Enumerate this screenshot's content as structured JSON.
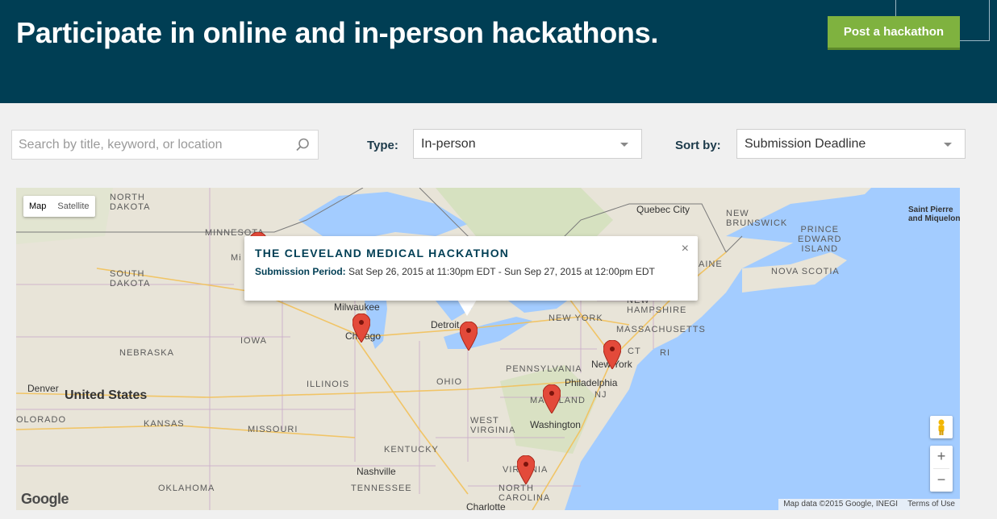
{
  "header": {
    "title": "Participate in online and in-person hackathons.",
    "post_button": "Post a hackathon"
  },
  "filters": {
    "search_placeholder": "Search by title, keyword, or location",
    "type_label": "Type:",
    "type_value": "In-person",
    "sort_label": "Sort by:",
    "sort_value": "Submission Deadline"
  },
  "map": {
    "type_options": [
      "Map",
      "Satellite"
    ],
    "selected_type": "Map",
    "labels": {
      "north_dakota": "NORTH\nDAKOTA",
      "south_dakota": "SOUTH\nDAKOTA",
      "minnesota": "MINNESOTA",
      "nebraska": "NEBRASKA",
      "iowa": "IOWA",
      "illinois": "ILLINOIS",
      "ohio": "OHIO",
      "kansas": "KANSAS",
      "missouri": "MISSOURI",
      "kentucky": "KENTUCKY",
      "tennessee": "TENNESSEE",
      "oklahoma": "OKLAHOMA",
      "colorado": "OLORADO",
      "west_virginia": "WEST\nVIRGINIA",
      "virginia": "VIRGINIA",
      "north_carolina": "NORTH\nCAROLINA",
      "pennsylvania": "PENNSYLVANIA",
      "new_york": "NEW YORK",
      "massachusetts": "MASSACHUSETTS",
      "new_hampshire": "NEW\nHAMPSHIRE",
      "maryland": "MARYLAND",
      "nj": "NJ",
      "ct": "CT",
      "ri": "RI",
      "maine": "AINE",
      "new_brunswick": "NEW\nBRUNSWICK",
      "pei": "PRINCE\nEDWARD\nISLAND",
      "nova_scotia": "NOVA SCOTIA",
      "united_states": "United States",
      "denver": "Denver",
      "milwaukee": "Milwaukee",
      "chicago": "Chicago",
      "detroit": "Detroit",
      "quebec_city": "Quebec City",
      "philadelphia": "Philadelphia",
      "new_york_city": "New York",
      "washington": "Washington",
      "nashville": "Nashville",
      "charlotte": "Charlotte",
      "st_pierre": "Saint Pierre\nand Miquelon",
      "mi_cut": "Mi"
    },
    "popup": {
      "title": "THE CLEVELAND MEDICAL HACKATHON",
      "period_label": "Submission Period:",
      "period_value": "Sat Sep 26, 2015 at 11:30pm EDT - Sun Sep 27, 2015 at 12:00pm EDT",
      "close_glyph": "×"
    },
    "zoom_in": "+",
    "zoom_out": "−",
    "logo": "Google",
    "attribution": "Map data ©2015 Google, INEGI",
    "terms": "Terms of Use",
    "marker_color": "#e34a3a"
  }
}
